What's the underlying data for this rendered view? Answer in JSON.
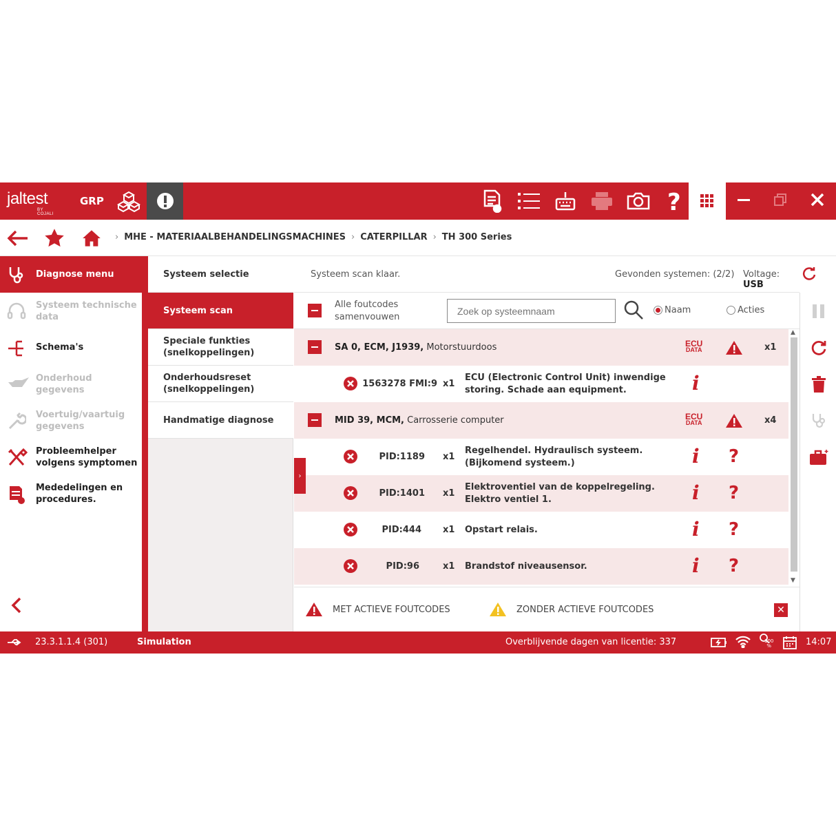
{
  "app": {
    "logo": "jaltest",
    "logo_sub": "BY COJALI",
    "mode": "GRP"
  },
  "breadcrumb": {
    "items": [
      "MHE - MATERIAALBEHANDELINGSMACHINES",
      "CATERPILLAR",
      "TH 300 Series"
    ]
  },
  "sidebar": {
    "header": "Diagnose menu",
    "items": [
      {
        "label": "Systeem technische data",
        "enabled": false,
        "icon": "headset-icon"
      },
      {
        "label": "Schema's",
        "enabled": true,
        "icon": "schema-icon"
      },
      {
        "label": "Onderhoud gegevens",
        "enabled": false,
        "icon": "oilcan-icon"
      },
      {
        "label": "Voertuig/vaartuig gegevens",
        "enabled": false,
        "icon": "wrench-icon"
      },
      {
        "label": "Probleemhelper volgens symptomen",
        "enabled": true,
        "icon": "tools-icon"
      },
      {
        "label": "Mededelingen en procedures.",
        "enabled": true,
        "icon": "document-icon"
      }
    ]
  },
  "menu": {
    "items": [
      {
        "label": "Systeem selectie",
        "active": false
      },
      {
        "label": "Systeem scan",
        "active": true
      },
      {
        "label": "Speciale funkties (snelkoppelingen)",
        "active": false
      },
      {
        "label": "Onderhoudsreset (snelkoppelingen)",
        "active": false
      },
      {
        "label": "Handmatige diagnose",
        "active": false
      }
    ]
  },
  "scan": {
    "status": "Systeem scan klaar.",
    "found": "Gevonden systemen: (2/2)",
    "voltage_label": "Voltage:",
    "voltage_value": "USB",
    "collapse_label": "Alle foutcodes samenvouwen",
    "search_placeholder": "Zoek op systeemnaam",
    "radio_name": "Naam",
    "radio_actions": "Acties",
    "ecu_line1": "ECU",
    "ecu_line2": "DATA"
  },
  "systems": [
    {
      "bold": "SA 0, ECM, J1939,",
      "rest": " Motorstuurdoos",
      "count": "x1",
      "codes": [
        {
          "code": "1563278 FMI:9",
          "mult": "x1",
          "desc": "ECU (Electronic Control Unit) inwendige storing. Schade aan equipment.",
          "help": false
        }
      ]
    },
    {
      "bold": "MID 39, MCM,",
      "rest": " Carrosserie computer",
      "count": "x4",
      "codes": [
        {
          "code": "PID:1189",
          "mult": "x1",
          "desc": "Regelhendel. Hydraulisch systeem. (Bijkomend systeem.)",
          "help": true
        },
        {
          "code": "PID:1401",
          "mult": "x1",
          "desc": "Elektroventiel van de koppelregeling. Elektro ventiel 1.",
          "help": true
        },
        {
          "code": "PID:444",
          "mult": "x1",
          "desc": "Opstart relais.",
          "help": true
        },
        {
          "code": "PID:96",
          "mult": "x1",
          "desc": "Brandstof niveausensor.",
          "help": true
        }
      ]
    }
  ],
  "legend": {
    "active": "MET ACTIEVE FOUTCODES",
    "inactive": "ZONDER ACTIEVE FOUTCODES"
  },
  "statusbar": {
    "version": "23.3.1.1.4 (301)",
    "mode": "Simulation",
    "license": "Overblijvende dagen van licentie: 337",
    "zoom": "100 %",
    "time": "14:07"
  },
  "colors": {
    "brand": "#c8202a",
    "warning": "#f3c121"
  }
}
